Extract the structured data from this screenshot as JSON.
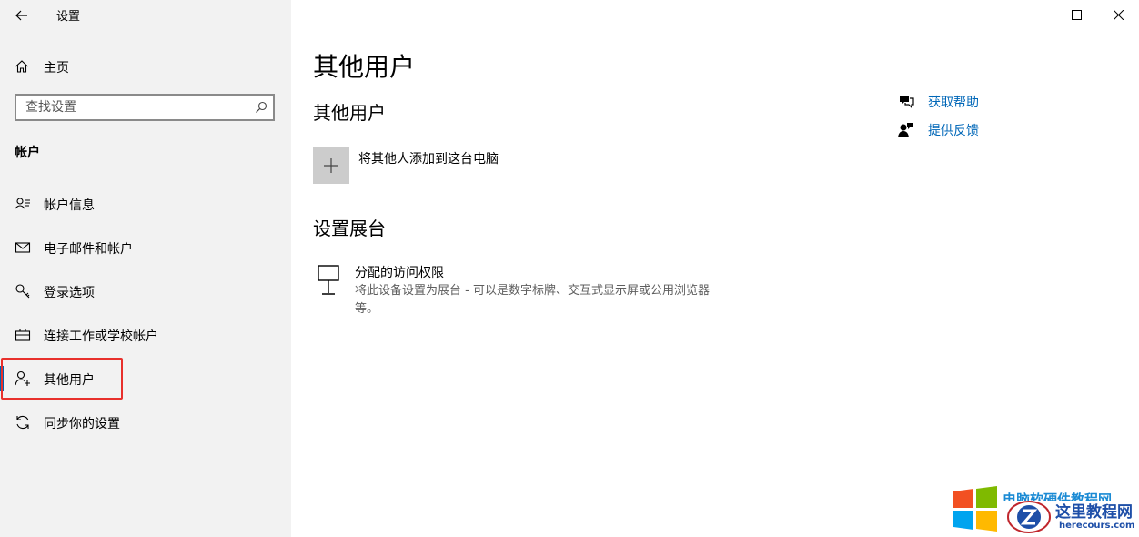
{
  "window": {
    "title": "设置"
  },
  "sidebar": {
    "home_label": "主页",
    "search_placeholder": "查找设置",
    "section_label": "帐户",
    "items": [
      {
        "label": "帐户信息",
        "icon": "account-info-icon"
      },
      {
        "label": "电子邮件和帐户",
        "icon": "mail-icon"
      },
      {
        "label": "登录选项",
        "icon": "key-icon"
      },
      {
        "label": "连接工作或学校帐户",
        "icon": "briefcase-icon"
      },
      {
        "label": "其他用户",
        "icon": "add-person-icon",
        "selected": true
      },
      {
        "label": "同步你的设置",
        "icon": "sync-icon"
      }
    ]
  },
  "main": {
    "page_title": "其他用户",
    "other_users": {
      "heading": "其他用户",
      "add_label": "将其他人添加到这台电脑"
    },
    "kiosk": {
      "heading": "设置展台",
      "title": "分配的访问权限",
      "description": "将此设备设置为展台 - 可以是数字标牌、交互式显示屏或公用浏览器等。"
    }
  },
  "help": {
    "get_help": "获取帮助",
    "feedback": "提供反馈"
  },
  "watermark": {
    "partial_text": "电脑软硬件教程网",
    "site_name": "这里教程网",
    "url": "herecours.com"
  },
  "colors": {
    "accent": "#0063b1",
    "link": "#0067b8",
    "highlight_box": "#e8302c",
    "sidebar_bg": "#f2f2f2"
  }
}
